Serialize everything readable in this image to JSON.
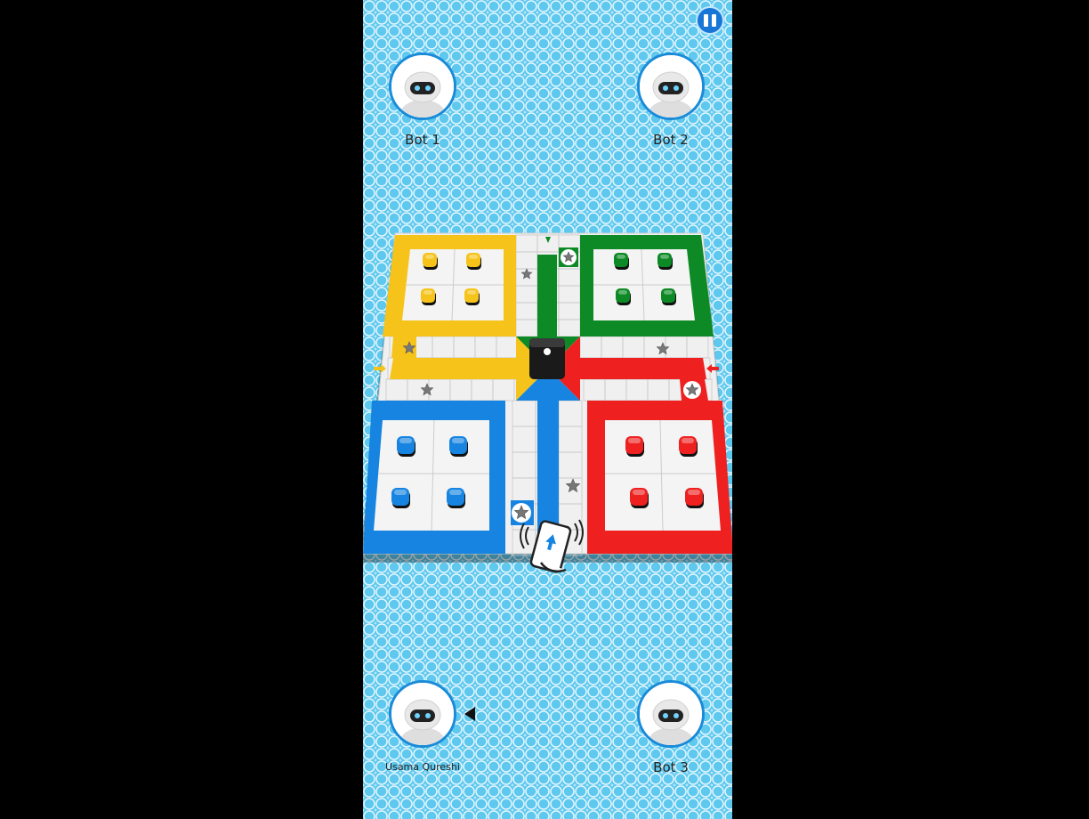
{
  "players": [
    {
      "id": "bot1",
      "name": "Bot 1"
    },
    {
      "id": "bot2",
      "name": "Bot 2"
    },
    {
      "id": "user",
      "name": "Usama Qureshi"
    },
    {
      "id": "bot3",
      "name": "Bot 3"
    }
  ],
  "colors": {
    "yellow": "#f6c31b",
    "green": "#0d8a25",
    "blue": "#1684e0",
    "red": "#ee2020",
    "board": "#f2f2f2",
    "avatar_ring": "#1a8bd8",
    "pause": "#1877d6"
  },
  "icons": {
    "pause": "pause-icon",
    "avatar": "robot-avatar-icon",
    "dice": "dice-icon",
    "safe": "star-icon",
    "shake": "shake-phone-icon",
    "turn": "turn-pointer-icon"
  },
  "dice": {
    "value": 1
  }
}
